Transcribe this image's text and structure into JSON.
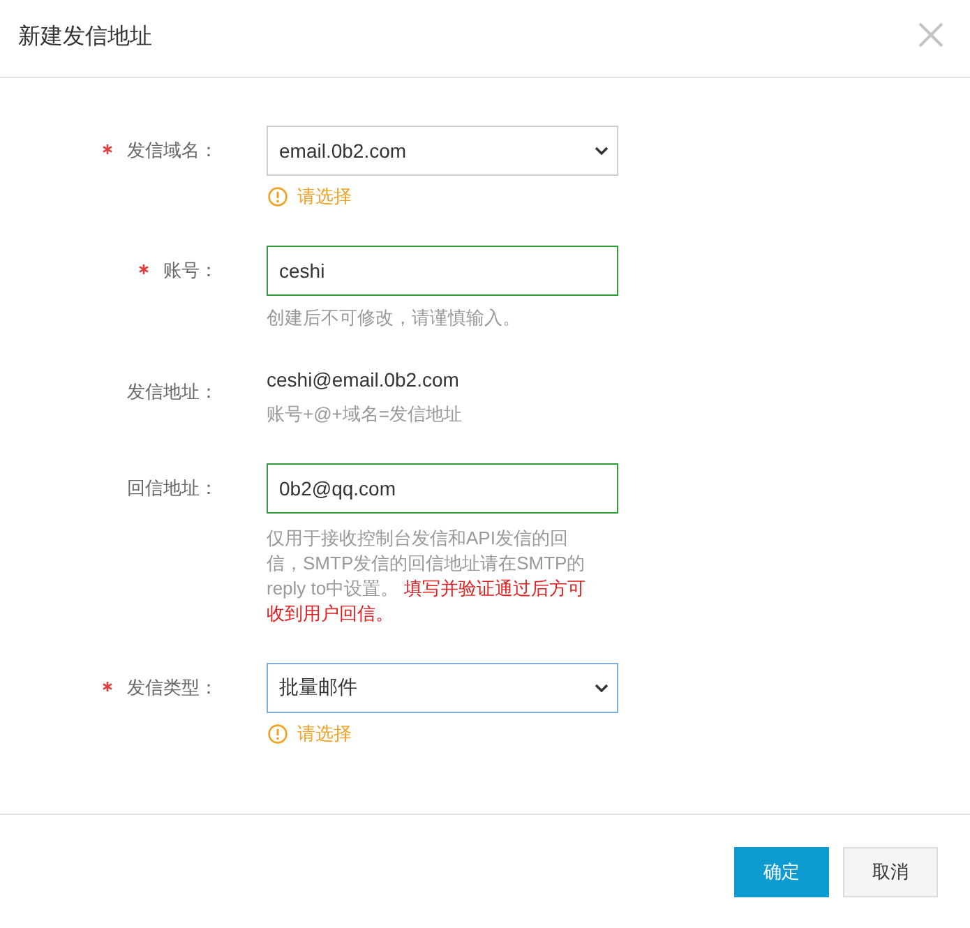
{
  "dialog": {
    "title": "新建发信地址"
  },
  "fields": [
    {
      "label": "发信域名：",
      "required": true,
      "kind": "select",
      "value": "email.0b2.com",
      "valid": false,
      "focused": false,
      "warning": "请选择"
    },
    {
      "label": "账号：",
      "required": true,
      "kind": "input",
      "value": "ceshi",
      "valid": true,
      "focused": false,
      "hint": "创建后不可修改，请谨慎输入。"
    },
    {
      "label": "发信地址：",
      "required": false,
      "kind": "text",
      "value": "ceshi@email.0b2.com",
      "hint": "账号+@+域名=发信地址"
    },
    {
      "label": "回信地址：",
      "required": false,
      "kind": "input",
      "value": "0b2@qq.com",
      "valid": true,
      "focused": false,
      "hint": "仅用于接收控制台发信和API发信的回信，SMTP发信的回信地址请在SMTP的reply to中设置。",
      "notice": "填写并验证通过后方可收到用户回信。"
    },
    {
      "label": "发信类型：",
      "required": true,
      "kind": "select",
      "value": "批量邮件",
      "valid": false,
      "focused": true,
      "warning": "请选择"
    }
  ],
  "buttons": [
    {
      "label": "确定",
      "kind": "primary"
    },
    {
      "label": "取消",
      "kind": "default"
    }
  ]
}
